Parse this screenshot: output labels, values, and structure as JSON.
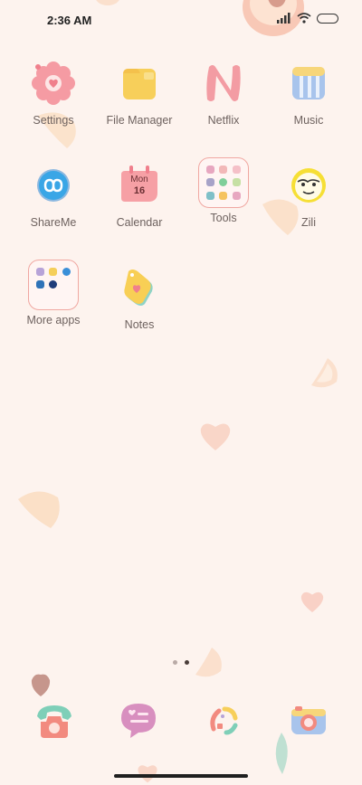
{
  "status": {
    "time": "2:36 AM",
    "signal_icon": "signal-icon",
    "wifi_icon": "wifi-icon",
    "battery_icon": "battery-icon"
  },
  "apps": [
    {
      "label": "Settings",
      "icon": "settings-icon"
    },
    {
      "label": "File Manager",
      "icon": "folder-icon"
    },
    {
      "label": "Netflix",
      "icon": "netflix-icon"
    },
    {
      "label": "Music",
      "icon": "music-icon"
    },
    {
      "label": "ShareMe",
      "icon": "shareme-icon"
    },
    {
      "label": "Calendar",
      "icon": "calendar-icon",
      "day": "Mon",
      "date": "16"
    },
    {
      "label": "Tools",
      "icon": "tools-folder-icon"
    },
    {
      "label": "Zili",
      "icon": "zili-icon"
    },
    {
      "label": "More apps",
      "icon": "more-apps-folder-icon"
    },
    {
      "label": "Notes",
      "icon": "notes-icon"
    }
  ],
  "pager": {
    "pages": 2,
    "active": 2
  },
  "dock": [
    {
      "icon": "phone-icon"
    },
    {
      "icon": "messages-icon"
    },
    {
      "icon": "browser-icon"
    },
    {
      "icon": "camera-icon"
    }
  ],
  "colors": {
    "background": "#fdf3ee",
    "accent_pink": "#f29a9a",
    "accent_yellow": "#f7cf5a",
    "folder_border": "#f0a7a1"
  }
}
